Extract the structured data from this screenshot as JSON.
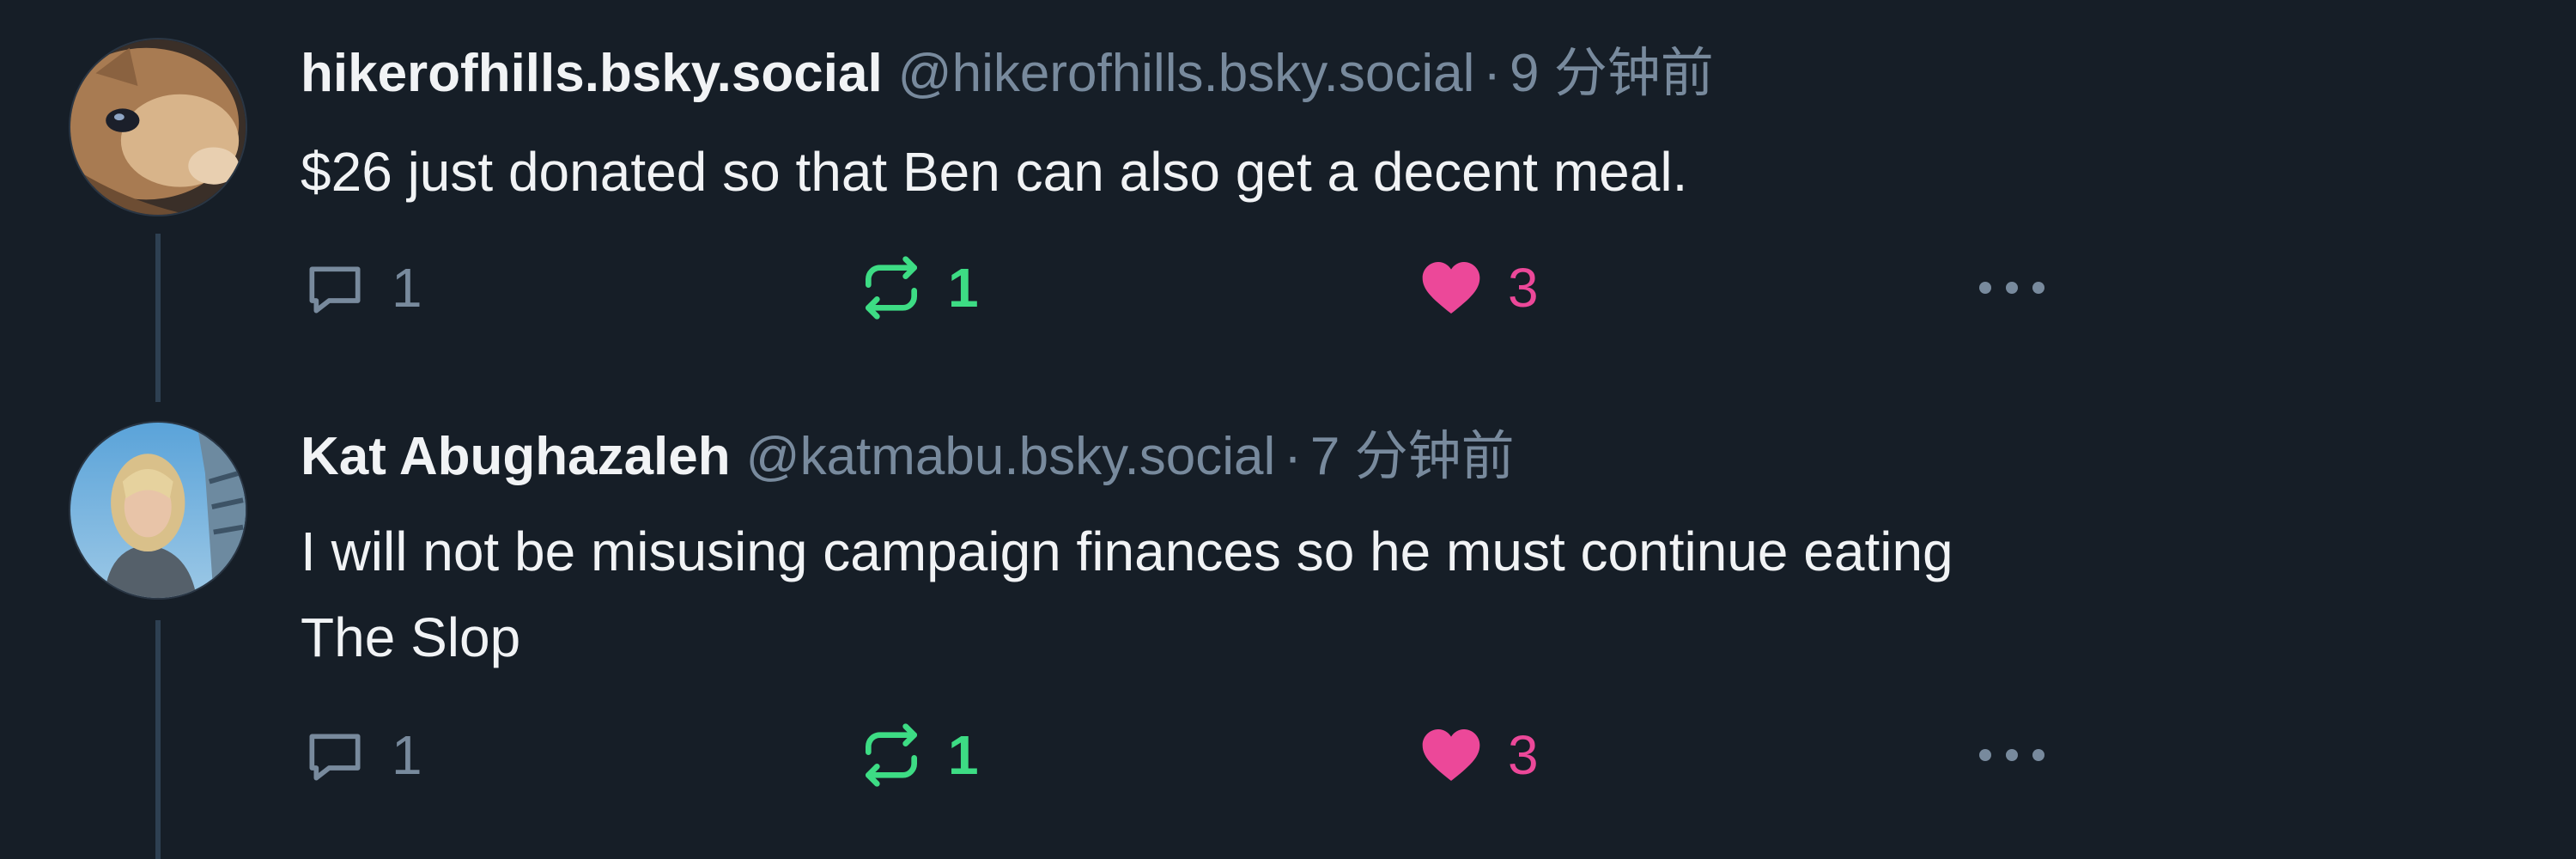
{
  "posts": [
    {
      "display_name": "hikerofhills.bsky.social",
      "handle": "@hikerofhills.bsky.social",
      "separator": "·",
      "time": "9 分钟前",
      "text_lines": [
        "$26 just donated so that Ben can also get a decent meal."
      ],
      "reply_count": "1",
      "repost_count": "1",
      "like_count": "3",
      "avatar_icon": "squirrel-avatar"
    },
    {
      "display_name": "Kat Abughazaleh",
      "handle": "@katmabu.bsky.social",
      "separator": "·",
      "time": "7 分钟前",
      "text_lines": [
        "I will not be misusing campaign finances so he must continue eating",
        "The Slop"
      ],
      "reply_count": "1",
      "repost_count": "1",
      "like_count": "3",
      "avatar_icon": "portrait-avatar"
    }
  ],
  "icons": {
    "reply": "speech-bubble-icon",
    "repost": "repost-arrows-icon",
    "like": "heart-icon",
    "more": "ellipsis-icon"
  },
  "colors": {
    "background": "#161e27",
    "primary_text": "#f1f3f5",
    "secondary_text": "#788a9d",
    "repost_active": "#3ddc84",
    "like_active": "#ec4899",
    "thread_line": "#2e4052"
  }
}
